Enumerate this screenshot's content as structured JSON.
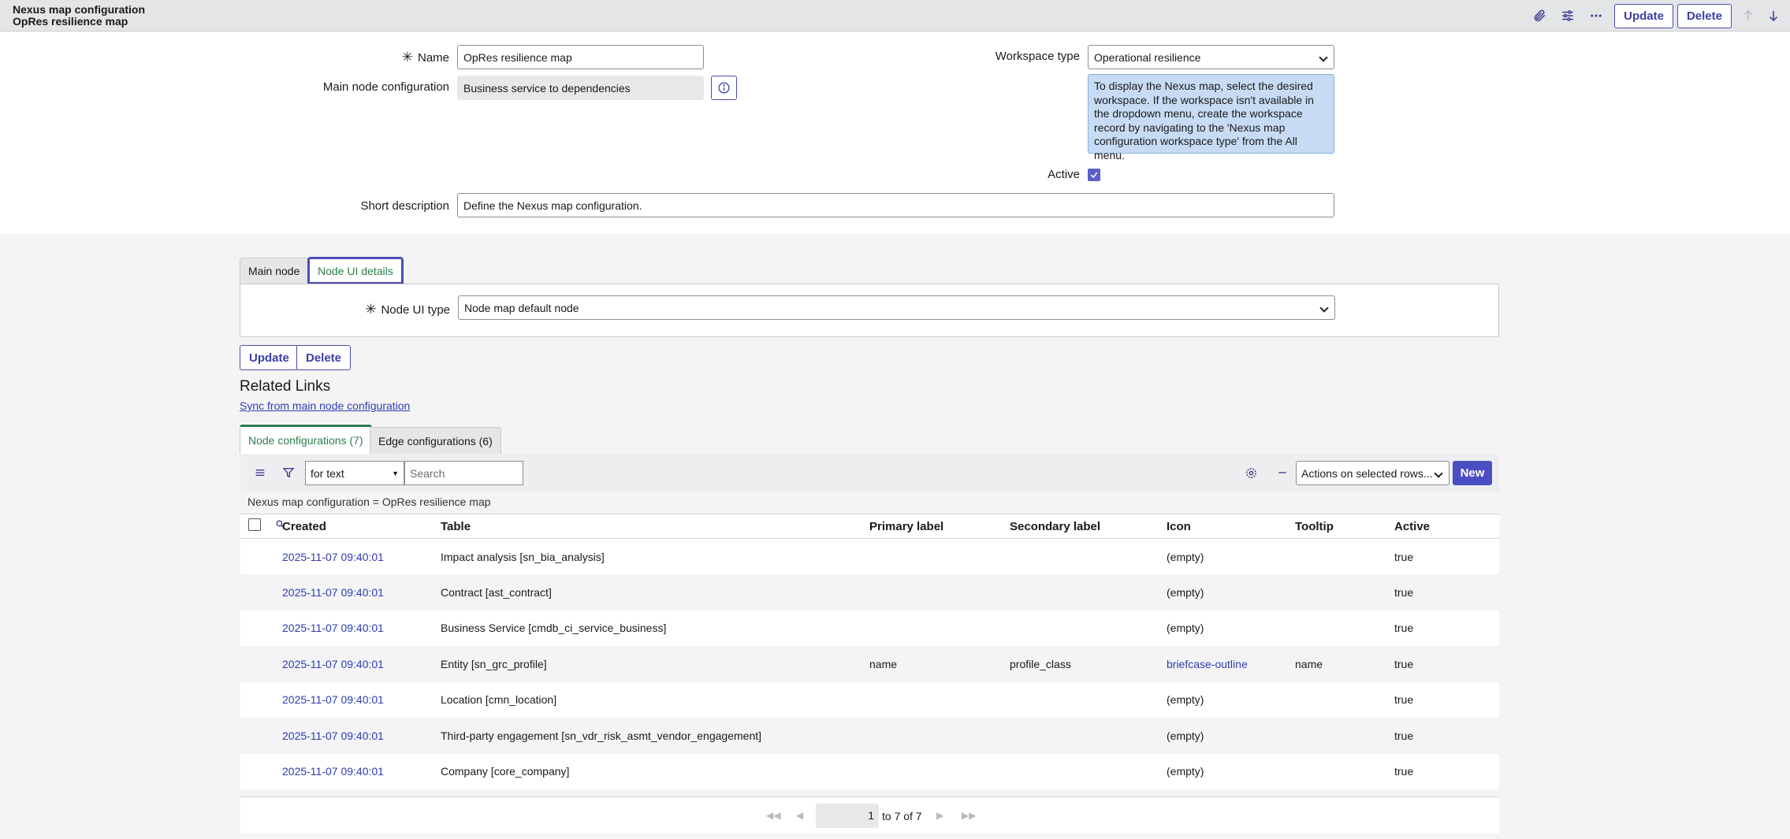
{
  "header": {
    "title_line1": "Nexus map configuration",
    "title_line2": "OpRes resilience map",
    "update_label": "Update",
    "delete_label": "Delete",
    "icons": [
      "paperclip-icon",
      "settings-sliders-icon",
      "more-icon",
      "arrow-up-icon",
      "arrow-down-icon"
    ]
  },
  "form": {
    "name_label": "Name",
    "name_value": "OpRes resilience map",
    "main_node_label": "Main node configuration",
    "main_node_value": "Business service to dependencies",
    "workspace_label": "Workspace type",
    "workspace_value": "Operational resilience",
    "workspace_help": "To display the Nexus map, select the desired workspace. If the workspace isn't available in the dropdown menu, create the workspace record by navigating to the 'Nexus map configuration workspace type' from the All menu.",
    "active_label": "Active",
    "active_checked": true,
    "short_desc_label": "Short description",
    "short_desc_value": "Define the Nexus map configuration."
  },
  "section_tabs": {
    "tab1": "Main node",
    "tab2": "Node UI details",
    "node_ui_type_label": "Node UI type",
    "node_ui_type_value": "Node map default node"
  },
  "bottom_buttons": {
    "update": "Update",
    "delete": "Delete"
  },
  "related_links": {
    "title": "Related Links",
    "sync_link": "Sync from main node configuration"
  },
  "list_tabs": {
    "tab1": "Node configurations (7)",
    "tab2": "Edge configurations (6)"
  },
  "list_toolbar": {
    "filter_type": "for text",
    "search_placeholder": "Search",
    "actions_select": "Actions on selected rows...",
    "new_label": "New"
  },
  "breadcrumb": "Nexus map configuration = OpRes resilience map",
  "table": {
    "headers": [
      "Created",
      "Table",
      "Primary label",
      "Secondary label",
      "Icon",
      "Tooltip",
      "Active"
    ],
    "rows": [
      {
        "created": "2025-11-07 09:40:01",
        "table": "Impact analysis [sn_bia_analysis]",
        "primary": "",
        "secondary": "",
        "icon": "(empty)",
        "tooltip": "",
        "active": "true"
      },
      {
        "created": "2025-11-07 09:40:01",
        "table": "Contract [ast_contract]",
        "primary": "",
        "secondary": "",
        "icon": "(empty)",
        "tooltip": "",
        "active": "true"
      },
      {
        "created": "2025-11-07 09:40:01",
        "table": "Business Service [cmdb_ci_service_business]",
        "primary": "",
        "secondary": "",
        "icon": "(empty)",
        "tooltip": "",
        "active": "true"
      },
      {
        "created": "2025-11-07 09:40:01",
        "table": "Entity [sn_grc_profile]",
        "primary": "name",
        "secondary": "profile_class",
        "icon": "briefcase-outline",
        "tooltip": "name",
        "active": "true"
      },
      {
        "created": "2025-11-07 09:40:01",
        "table": "Location [cmn_location]",
        "primary": "",
        "secondary": "",
        "icon": "(empty)",
        "tooltip": "",
        "active": "true"
      },
      {
        "created": "2025-11-07 09:40:01",
        "table": "Third-party engagement [sn_vdr_risk_asmt_vendor_engagement]",
        "primary": "",
        "secondary": "",
        "icon": "(empty)",
        "tooltip": "",
        "active": "true"
      },
      {
        "created": "2025-11-07 09:40:01",
        "table": "Company [core_company]",
        "primary": "",
        "secondary": "",
        "icon": "(empty)",
        "tooltip": "",
        "active": "true"
      }
    ]
  },
  "pager": {
    "current": "1",
    "range_text": "to 7 of 7"
  },
  "colors": {
    "accent": "#4b4ec2",
    "link": "#2f3bb0",
    "active_tab": "#2d7d4e",
    "help_bg": "#c7dcf4"
  }
}
